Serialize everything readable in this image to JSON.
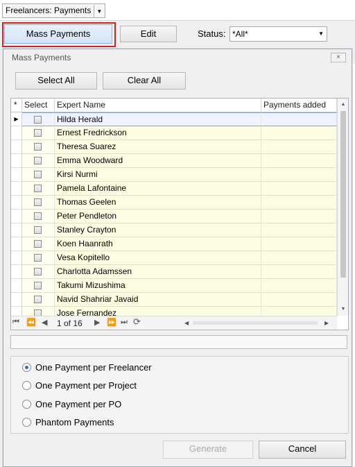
{
  "top": {
    "title_combo": "Freelancers: Payments",
    "mass_payments_label": "Mass Payments",
    "edit_label": "Edit",
    "status_label": "Status:",
    "status_value": "*All*"
  },
  "dialog": {
    "title": "Mass Payments",
    "close": "×",
    "select_all": "Select All",
    "clear_all": "Clear All",
    "grid": {
      "columns": [
        "*",
        "Select",
        "Expert Name",
        "Payments added"
      ],
      "rows": [
        "Hilda Herald",
        "Ernest Fredrickson",
        "Theresa Suarez",
        "Emma Woodward",
        "Kirsi Nurmi",
        "Pamela Lafontaine",
        "Thomas Geelen",
        "Peter Pendleton",
        "Stanley Crayton",
        "Koen Haanrath",
        "Vesa Kopitello",
        "Charlotta Adamssen",
        "Takumi Mizushima",
        "Navid Shahriar Javaid",
        "Jose Fernandez"
      ],
      "pager_text": "1 of 16"
    },
    "options": [
      {
        "label": "One Payment per Freelancer",
        "checked": true
      },
      {
        "label": "One Payment per Project",
        "checked": false
      },
      {
        "label": "One Payment per PO",
        "checked": false
      },
      {
        "label": "Phantom Payments",
        "checked": false
      }
    ],
    "generate_label": "Generate",
    "cancel_label": "Cancel"
  },
  "colors": {
    "highlight_border": "#d32020",
    "grid_row_bg": "#fdfde3",
    "radio_dot": "#3a6bb4"
  }
}
